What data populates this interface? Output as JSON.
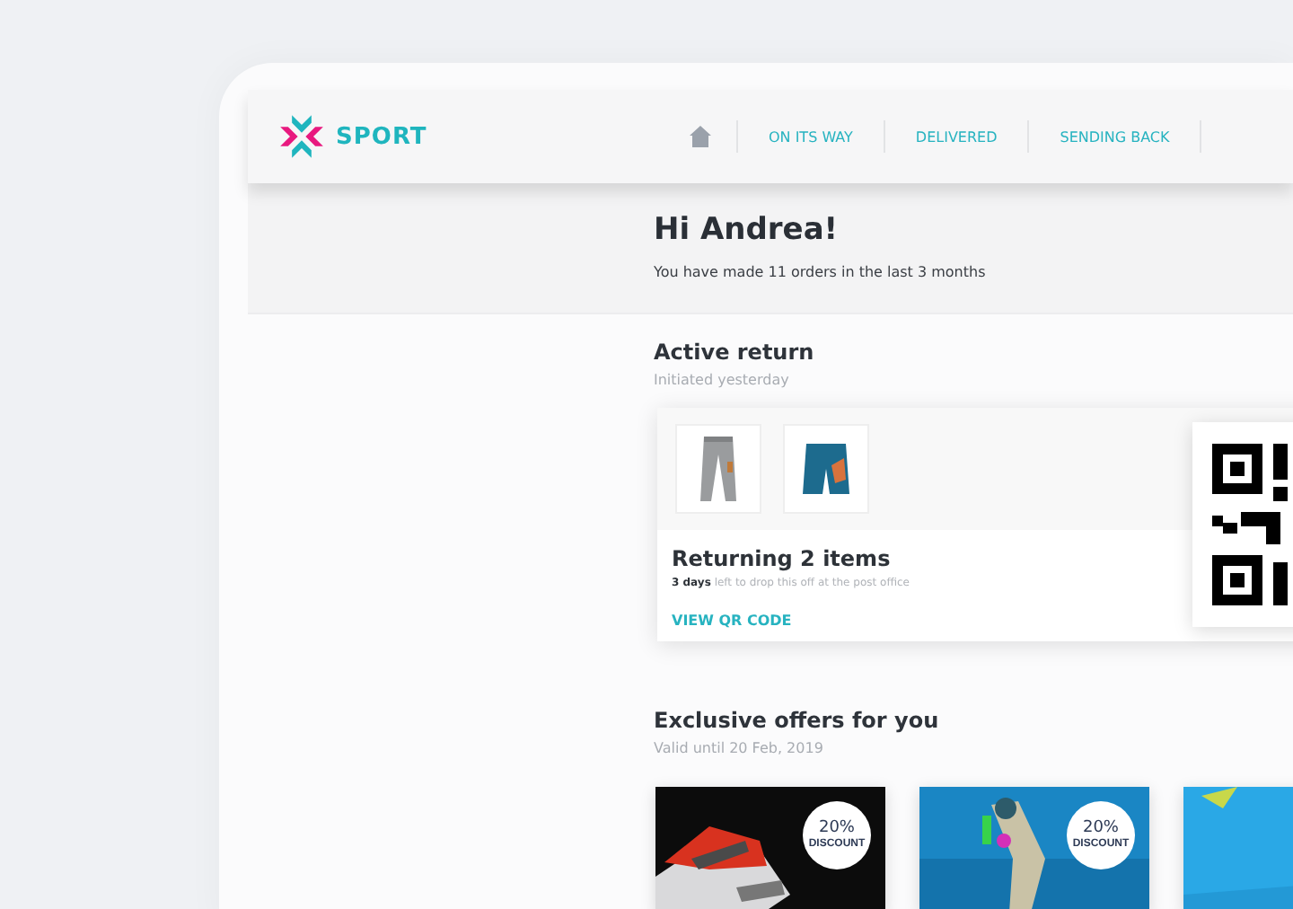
{
  "brand": {
    "name": "SPORT"
  },
  "nav": [
    {
      "label": "ON ITS WAY"
    },
    {
      "label": "DELIVERED"
    },
    {
      "label": "SENDING BACK"
    }
  ],
  "greeting": {
    "title": "Hi Andrea!",
    "subtitle": "You have made 11 orders in the last 3 months"
  },
  "active_return": {
    "title": "Active return",
    "subtitle": "Initiated yesterday",
    "items": [
      {
        "kind": "picture"
      },
      {
        "kind": "picture"
      }
    ],
    "heading": "Returning 2 items",
    "note": "**3 days** left to drop this off at the post office",
    "link": "VIEW QR CODE"
  },
  "offers": {
    "title": "Exclusive offers for you",
    "subtitle": "Valid until 20 Feb, 2019",
    "cards": [
      {
        "kind": "picture",
        "discount": "20%",
        "discount_label": "DISCOUNT"
      },
      {
        "kind": "picture",
        "discount": "20%",
        "discount_label": "DISCOUNT"
      },
      {
        "kind": "picture"
      }
    ]
  }
}
